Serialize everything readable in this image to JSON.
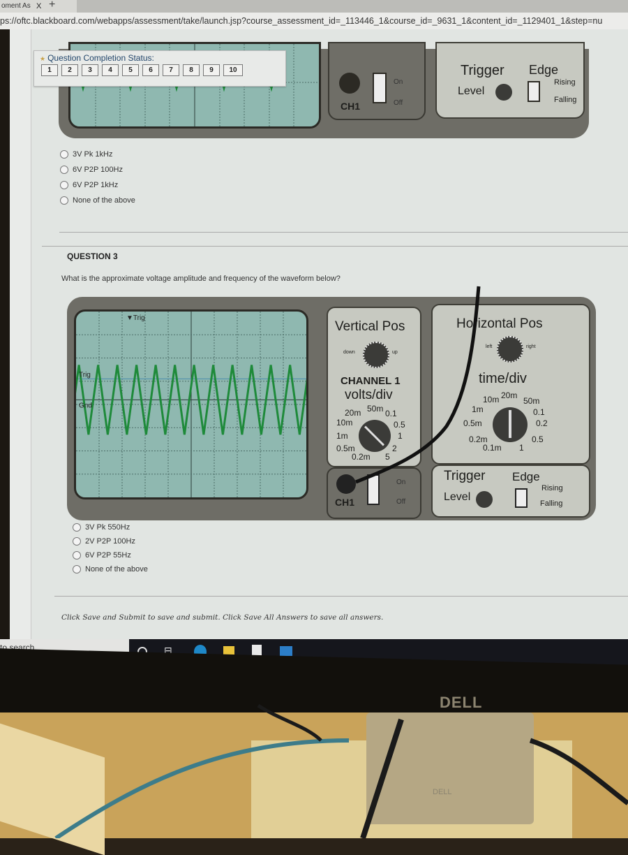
{
  "browser": {
    "tab_title": "oment As",
    "tab_close": "X",
    "new_tab": "+",
    "url": "ps://oftc.blackboard.com/webapps/assessment/take/launch.jsp?course_assessment_id=_113446_1&course_id=_9631_1&content_id=_1129401_1&step=nu"
  },
  "completion_status": {
    "title": "Question Completion Status:",
    "questions": [
      "1",
      "2",
      "3",
      "4",
      "5",
      "6",
      "7",
      "8",
      "9",
      "10"
    ]
  },
  "scope_top": {
    "ch1_label": "CH1",
    "switch_on": "On",
    "switch_off": "Off",
    "trigger_label": "Trigger",
    "edge_label": "Edge",
    "level_label": "Level",
    "rising_label": "Rising",
    "falling_label": "Falling"
  },
  "question2": {
    "answers": [
      "3V Pk  1kHz",
      "6V P2P 100Hz",
      "6V P2P 1kHz",
      "None of the above"
    ]
  },
  "question3": {
    "title": "QUESTION 3",
    "prompt": "What is the approximate voltage amplitude and frequency of the waveform below?",
    "scope": {
      "trig_marker": "Trig",
      "trig_level_marker": "Trig",
      "gnd_marker": "Gnd",
      "vertical_pos_label": "Vertical Pos",
      "vertical_down": "down",
      "vertical_up": "up",
      "channel_label": "CHANNEL 1",
      "volts_div_label": "volts/div",
      "volts_div_options": [
        "20m",
        "50m",
        "0.1",
        "10m",
        "0.5",
        "1m",
        "1",
        "0.5m",
        "2",
        "0.2m",
        "5"
      ],
      "volts_div_selected": "1",
      "horizontal_pos_label": "Horizontal Pos",
      "horizontal_left": "left",
      "horizontal_right": "right",
      "time_div_label": "time/div",
      "time_div_options": [
        "10m",
        "20m",
        "50m",
        "1m",
        "0.1",
        "0.5m",
        "0.2",
        "0.2m",
        "0.5",
        "0.1m",
        "1"
      ],
      "time_div_selected": "20m",
      "ch1_label": "CH1",
      "switch_on": "On",
      "switch_off": "Off",
      "trigger_label": "Trigger",
      "edge_label": "Edge",
      "level_label": "Level",
      "rising_label": "Rising",
      "falling_label": "Falling",
      "waveform": "triangle",
      "waveform_cycles_visible": 12,
      "waveform_peak_divisions": 1.5,
      "waveform_color": "#1e8a3a",
      "screen_color": "#8fb8b0"
    },
    "answers": [
      "3V Pk 550Hz",
      "2V P2P 100Hz",
      "6V P2P 55Hz",
      "None of the above"
    ]
  },
  "footer": {
    "instructions": "Click Save and Submit to save and submit. Click Save All Answers to save all answers."
  },
  "taskbar": {
    "search_placeholder": "to search",
    "icons": [
      "cortana-icon",
      "task-view-icon",
      "edge-icon",
      "file-explorer-icon",
      "store-icon",
      "mail-icon"
    ]
  },
  "monitor": {
    "brand": "DELL",
    "stand_brand": "DELL"
  }
}
